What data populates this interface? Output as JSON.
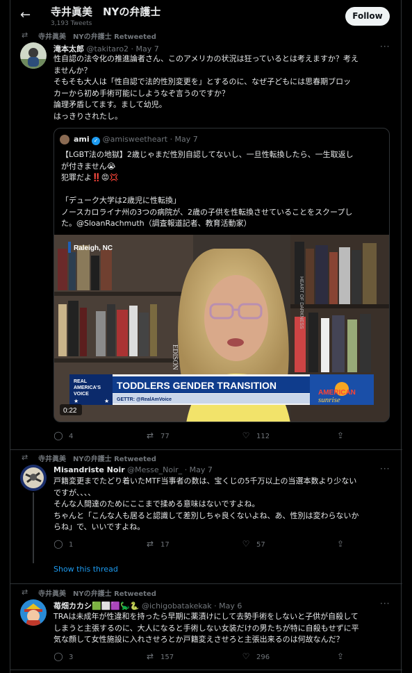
{
  "header": {
    "title": "寺井眞美　NYの弁護士",
    "tweet_count": "3,193 Tweets",
    "follow_label": "Follow"
  },
  "tweets": [
    {
      "retweet_label": "寺井眞美　NYの弁護士 Retweeted",
      "name": "滝本太郎",
      "handle": "@takitaro2",
      "date": "· May 7",
      "text_lines": [
        "性自認の法令化の推進論者さん、このアメリカの状況は狂っているとは考えますか？考え",
        "ませんか？",
        "そもそも大人は「性自認で法的性別変更を」とするのに、なぜ子どもには思春期ブロッ",
        "カーから初め手術可能にしようなぞ言うのですか？",
        "論理矛盾してます。まして幼児。",
        "はっきりされたし。"
      ],
      "quote": {
        "name": "ami",
        "handle": "@amisweetheart",
        "date": "· May 7",
        "text_lines": [
          "【LGBT法の地獄】2歳じゃまだ性別自認してないし、一旦性転換したら、一生取返し",
          "が付きません😭",
          "犯罪だよ‼️😡💢",
          "",
          "「デューク大学は2歳児に性転換」",
          "ノースカロライナ州の3つの病院が、2歳の子供を性転換させていることをスクープし",
          "た。@SloanRachmuth（調査報道記者、教育活動家）"
        ],
        "video": {
          "location": "Raleigh, NC",
          "banner_text": "TODDLERS GENDER TRANSITION",
          "banner_sub": "GETTR: @RealAmVoice",
          "brand_left_1": "REAL",
          "brand_left_2": "AMERICA'S",
          "brand_left_3": "VOICE",
          "brand_right_1": "AMERICAN",
          "brand_right_2": "sunrise",
          "duration": "0:22",
          "book_1": "EDISON",
          "book_2": "HEART OF DARKNESS"
        }
      },
      "replies": "4",
      "retweets": "77",
      "likes": "112"
    },
    {
      "retweet_label": "寺井眞美　NYの弁護士 Retweeted",
      "name": "Misandriste Noir",
      "handle": "@Messe_Noir_",
      "date": "· May 7",
      "text_lines": [
        "戸籍変更までたどり着いたMTF当事者の数は、宝くじの5千万以上の当選本数より少ない",
        "ですが、、、、",
        "そんな人間達のためにここまで揉める意味はないですよね。",
        "ちゃんと「こんな人も居ると認識して差別しちゃ良くないよね、あ、性別は変わらないか",
        "らね」で、いいですよね。"
      ],
      "replies": "1",
      "retweets": "17",
      "likes": "57",
      "show_thread": "Show this thread"
    },
    {
      "retweet_label": "寺井眞美　NYの弁護士 Retweeted",
      "name": "苺畑カカシ🟩⬜🟪🦕🐍",
      "handle": "@ichigobatakekak",
      "date": "· May 6",
      "text_lines": [
        "TRAは未成年が性違和を持ったら早期に薬漬けにして去勢手術をしないと子供が自殺して",
        "しまうと主張するのに、大人になると手術しない女装だけの男たちが特に自殺もせずに平",
        "気な顔して女性施設に入れさせろとか戸籍変えさせろと主張出来るのは何故なんだ？"
      ],
      "replies": "3",
      "retweets": "157",
      "likes": "296"
    }
  ],
  "icons": {
    "back": "←",
    "retweet": "⇄",
    "more": "···",
    "reply": "◯",
    "rt_action": "⇄",
    "like": "♡",
    "share": "⇪",
    "check": "✓"
  }
}
